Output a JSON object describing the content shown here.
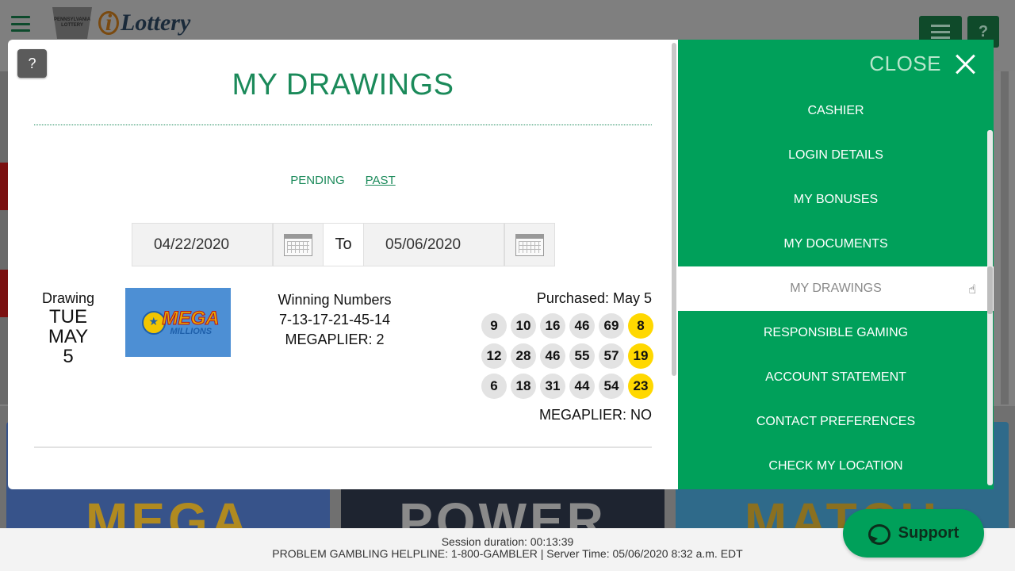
{
  "header": {
    "logo_alt": "Pennsylvania Lottery",
    "brand_name": "Lottery",
    "keystone_text": "PENNSYLVANIA LOTTERY",
    "help_label": "?"
  },
  "modal": {
    "help_label": "?",
    "title": "MY DRAWINGS",
    "tabs": [
      {
        "label": "PENDING",
        "active": false
      },
      {
        "label": "PAST",
        "active": true
      }
    ],
    "date_from": "04/22/2020",
    "date_to": "05/06/2020",
    "to_label": "To"
  },
  "drawing": {
    "label": "Drawing",
    "day": "TUE",
    "month": "MAY",
    "date": "5",
    "game_logo_word": "MEGA",
    "game_logo_sub": "MILLIONS",
    "winning_label": "Winning Numbers",
    "winning_numbers": "7-13-17-21-45-14",
    "winning_megaplier": "MEGAPLIER: 2",
    "purchased": "Purchased: May 5",
    "lines": [
      {
        "numbers": [
          "9",
          "10",
          "16",
          "46",
          "69"
        ],
        "mega": "8"
      },
      {
        "numbers": [
          "12",
          "28",
          "46",
          "55",
          "57"
        ],
        "mega": "19"
      },
      {
        "numbers": [
          "6",
          "18",
          "31",
          "44",
          "54"
        ],
        "mega": "23"
      }
    ],
    "megaplier": "MEGAPLIER: NO"
  },
  "side_menu": {
    "close_label": "CLOSE",
    "items": [
      {
        "label": "CASHIER",
        "selected": false
      },
      {
        "label": "LOGIN DETAILS",
        "selected": false
      },
      {
        "label": "MY BONUSES",
        "selected": false
      },
      {
        "label": "MY DOCUMENTS",
        "selected": false
      },
      {
        "label": "MY DRAWINGS",
        "selected": true
      },
      {
        "label": "RESPONSIBLE GAMING",
        "selected": false
      },
      {
        "label": "ACCOUNT STATEMENT",
        "selected": false
      },
      {
        "label": "CONTACT PREFERENCES",
        "selected": false
      },
      {
        "label": "CHECK MY LOCATION",
        "selected": false
      }
    ]
  },
  "tiles": {
    "tile1": "MEGA",
    "tile2": "POWER",
    "tile3": "MATCH"
  },
  "footer": {
    "session": "Session duration: 00:13:39",
    "helpline": "PROBLEM GAMBLING HELPLINE: 1-800-GAMBLER | Server Time: 05/06/2020 8:32 a.m. EDT"
  },
  "support": {
    "label": "Support"
  },
  "colors": {
    "brand_green": "#00a05a",
    "title_green": "#1b8a5a",
    "mega_ball_yellow": "#ffd800"
  }
}
